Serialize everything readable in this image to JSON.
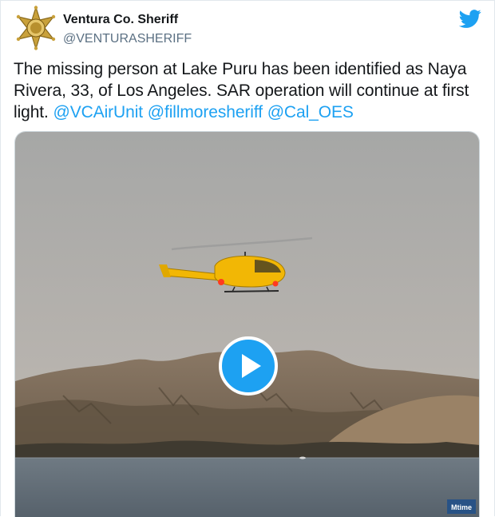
{
  "tweet": {
    "display_name": "Ventura Co. Sheriff",
    "handle": "@VENTURASHERIFF",
    "text_main": "The missing person at Lake Puru has been identified as Naya Rivera, 33, of Los Angeles. SAR operation will continue at first light. ",
    "mentions": [
      "@VCAirUnit",
      "@fillmoresheriff",
      "@Cal_OES"
    ]
  },
  "icons": {
    "avatar": "sheriff-star-badge",
    "brand": "twitter-bird-icon",
    "play": "play-icon",
    "watermark": "mtime-logo"
  },
  "colors": {
    "link": "#1da1f2",
    "text": "#14171a",
    "secondary": "#5b7083",
    "badge_gold": "#c9a13b",
    "helicopter_yellow": "#f2b705"
  },
  "watermark_text": "Mtime"
}
